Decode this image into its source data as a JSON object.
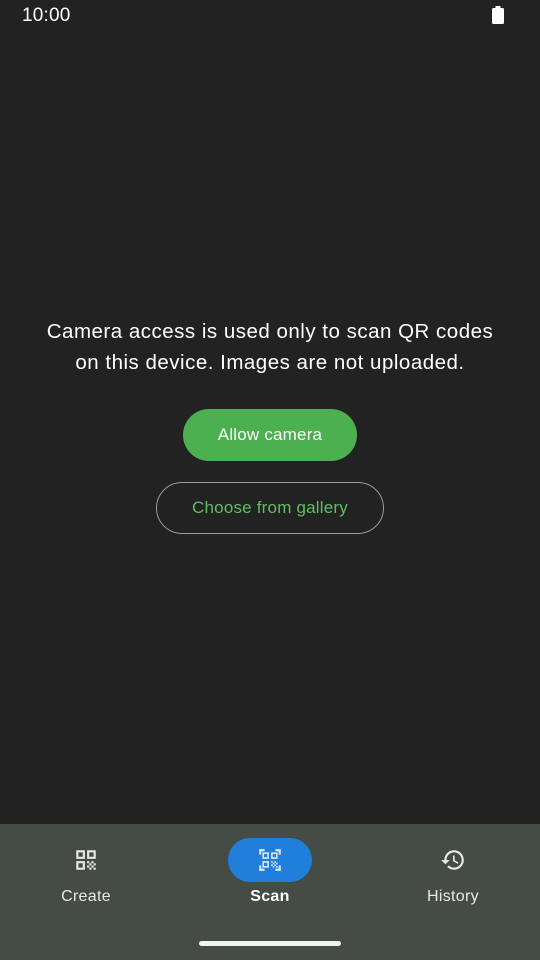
{
  "status_bar": {
    "time": "10:00",
    "battery_icon": "battery-full-icon"
  },
  "permission": {
    "message_line1": "Camera access is used only to scan QR codes",
    "message_line2": "on this device. Images are not uploaded.",
    "allow_label": "Allow camera",
    "gallery_label": "Choose from gallery"
  },
  "nav": {
    "selected": "scan",
    "items": [
      {
        "id": "create",
        "label": "Create",
        "icon": "qr-code-icon"
      },
      {
        "id": "scan",
        "label": "Scan",
        "icon": "qr-scan-icon"
      },
      {
        "id": "history",
        "label": "History",
        "icon": "history-icon"
      }
    ]
  },
  "colors": {
    "background": "#222222",
    "accent_green": "#4caf50",
    "nav_background": "#444c45",
    "nav_selected": "#1f7fdb"
  }
}
